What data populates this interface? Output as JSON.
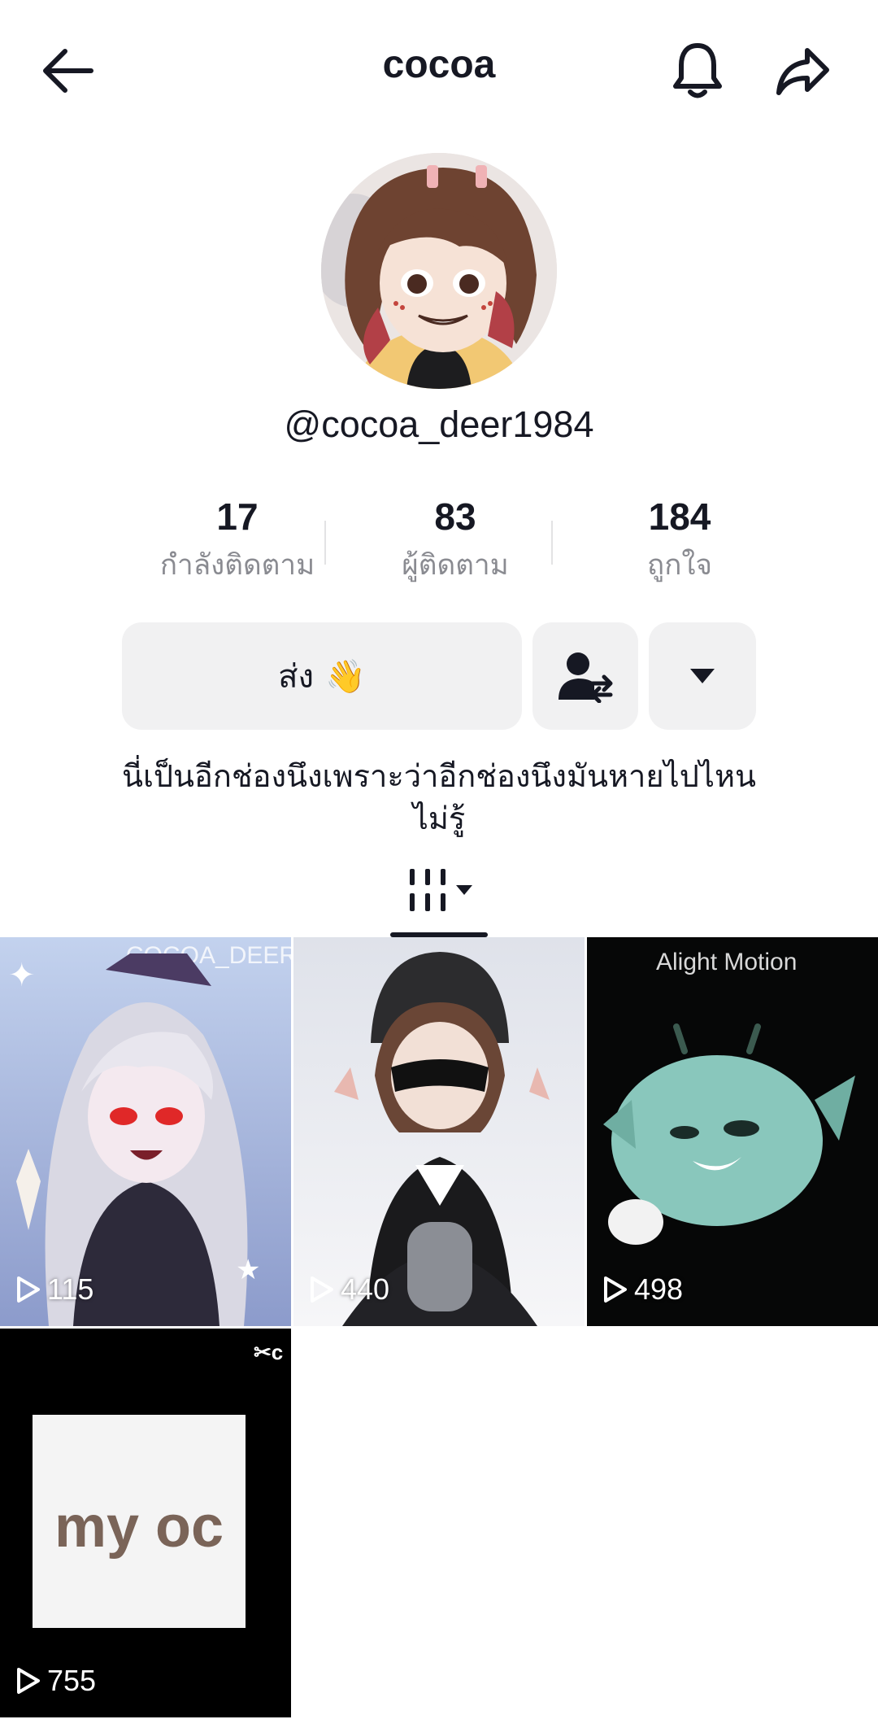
{
  "header": {
    "title": "cocoa",
    "back_icon": "arrow-left-icon",
    "bell_icon": "bell-icon",
    "share_icon": "share-arrow-icon"
  },
  "profile": {
    "username": "@cocoa_deer1984",
    "avatar_icon": "avatar-image"
  },
  "stats": [
    {
      "value": "17",
      "label": "กำลังติดตาม"
    },
    {
      "value": "83",
      "label": "ผู้ติดตาม"
    },
    {
      "value": "184",
      "label": "ถูกใจ"
    }
  ],
  "actions": {
    "send_label": "ส่ง",
    "send_emoji": "👋",
    "friends_icon": "add-friend-swap-icon",
    "more_icon": "caret-down-icon"
  },
  "bio": {
    "line1": "นี่เป็นอีกช่องนึงเพราะว่าอีกช่องนึงมันหายไปไหน",
    "line2": "ไม่รู้"
  },
  "tabs": {
    "active_icon": "grid-bars-icon",
    "dropdown_icon": "caret-down-icon"
  },
  "videos": [
    {
      "views": "115",
      "overlay_text": "COCOA_DEER",
      "colors": [
        "#b9c9e8",
        "#5d5f86"
      ]
    },
    {
      "views": "440",
      "overlay_text": "",
      "colors": [
        "#d9dde7",
        "#f4f4f6"
      ]
    },
    {
      "views": "498",
      "overlay_text": "Alight Motion",
      "colors": [
        "#050505",
        "#0c1311"
      ]
    },
    {
      "views": "755",
      "overlay_text": "my oc",
      "colors": [
        "#000000",
        "#111111"
      ]
    }
  ],
  "colors": {
    "text": "#161823",
    "muted": "#8a8b91",
    "button_bg": "#f1f1f2"
  }
}
